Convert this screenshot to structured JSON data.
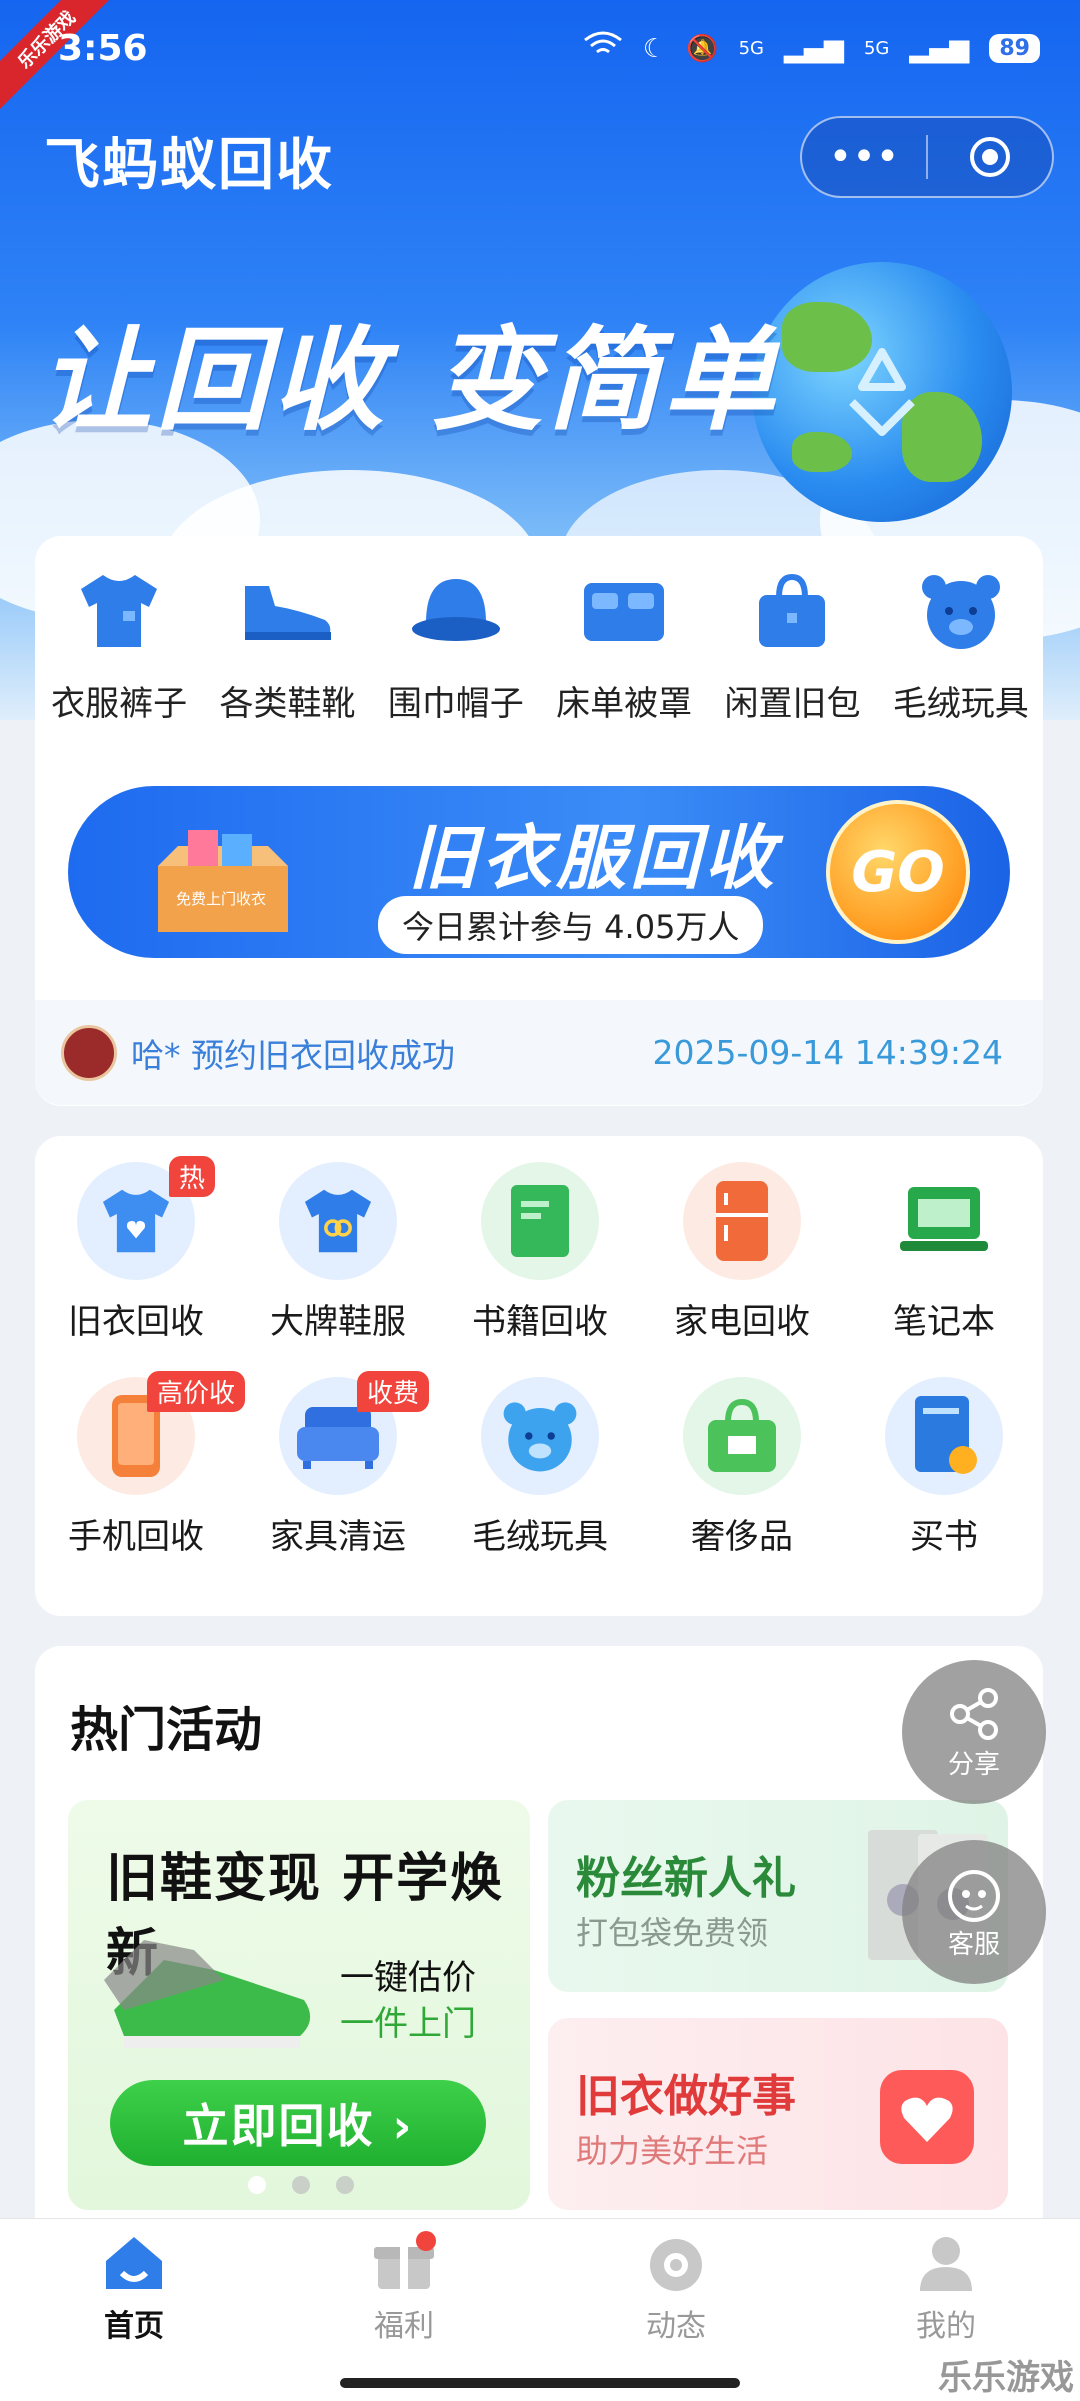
{
  "status": {
    "time": "3:56",
    "signal1": "5G",
    "signal2": "5G",
    "battery": "89"
  },
  "corner_tag": "乐乐游戏",
  "header": {
    "title": "飞蚂蚁回收",
    "more_icon": "more-dots-icon",
    "close_icon": "target-icon"
  },
  "hero": {
    "slogan": "让回收 变简单"
  },
  "categories": [
    {
      "label": "衣服裤子",
      "icon": "tshirt-icon"
    },
    {
      "label": "各类鞋靴",
      "icon": "shoe-icon"
    },
    {
      "label": "围巾帽子",
      "icon": "hat-icon"
    },
    {
      "label": "床单被罩",
      "icon": "bed-icon"
    },
    {
      "label": "闲置旧包",
      "icon": "bag-icon"
    },
    {
      "label": "毛绒玩具",
      "icon": "bear-icon"
    }
  ],
  "banner": {
    "title": "旧衣服回收",
    "subtitle": "今日累计参与 4.05万人",
    "go_label": "GO",
    "box_text": "免费上门收衣"
  },
  "notice": {
    "message": "哈* 预约旧衣回收成功",
    "time": "2025-09-14 14:39:24"
  },
  "services": [
    {
      "label": "旧衣回收",
      "badge": "热",
      "icon": "tshirt-heart-icon",
      "color": "#3d8ef0"
    },
    {
      "label": "大牌鞋服",
      "badge": "",
      "icon": "brand-shirt-icon",
      "color": "#2f7de8"
    },
    {
      "label": "书籍回收",
      "badge": "",
      "icon": "book-icon",
      "color": "#35b85a"
    },
    {
      "label": "家电回收",
      "badge": "",
      "icon": "fridge-icon",
      "color": "#f06a3a"
    },
    {
      "label": "笔记本",
      "badge": "",
      "icon": "laptop-icon",
      "color": "#27a84a"
    },
    {
      "label": "手机回收",
      "badge": "高价收",
      "icon": "phone-icon",
      "color": "#f5803a"
    },
    {
      "label": "家具清运",
      "badge": "收费",
      "icon": "sofa-icon",
      "color": "#2f6fe0"
    },
    {
      "label": "毛绒玩具",
      "badge": "",
      "icon": "bear-icon",
      "color": "#3da3ef"
    },
    {
      "label": "奢侈品",
      "badge": "",
      "icon": "luxury-bag-icon",
      "color": "#4cc25a"
    },
    {
      "label": "买书",
      "badge": "",
      "icon": "buy-book-icon",
      "color": "#2a7ae0"
    }
  ],
  "activities": {
    "section_title": "热门活动",
    "left": {
      "title": "旧鞋变现 开学焕新",
      "line1": "一键估价",
      "line2": "一件上门",
      "button": "立即回收 ›"
    },
    "right_top": {
      "title": "粉丝新人礼",
      "subtitle": "打包袋免费领",
      "title_color": "#2a8a3a"
    },
    "right_bottom": {
      "title": "旧衣做好事",
      "subtitle": "助力美好生活",
      "title_color": "#e03a3a"
    }
  },
  "float": {
    "share": "分享",
    "service": "客服"
  },
  "tabs": [
    {
      "label": "首页",
      "icon": "home-icon",
      "active": true
    },
    {
      "label": "福利",
      "icon": "gift-icon",
      "active": false
    },
    {
      "label": "动态",
      "icon": "camera-icon",
      "active": false
    },
    {
      "label": "我的",
      "icon": "user-icon",
      "active": false
    }
  ],
  "watermark": "乐乐游戏"
}
